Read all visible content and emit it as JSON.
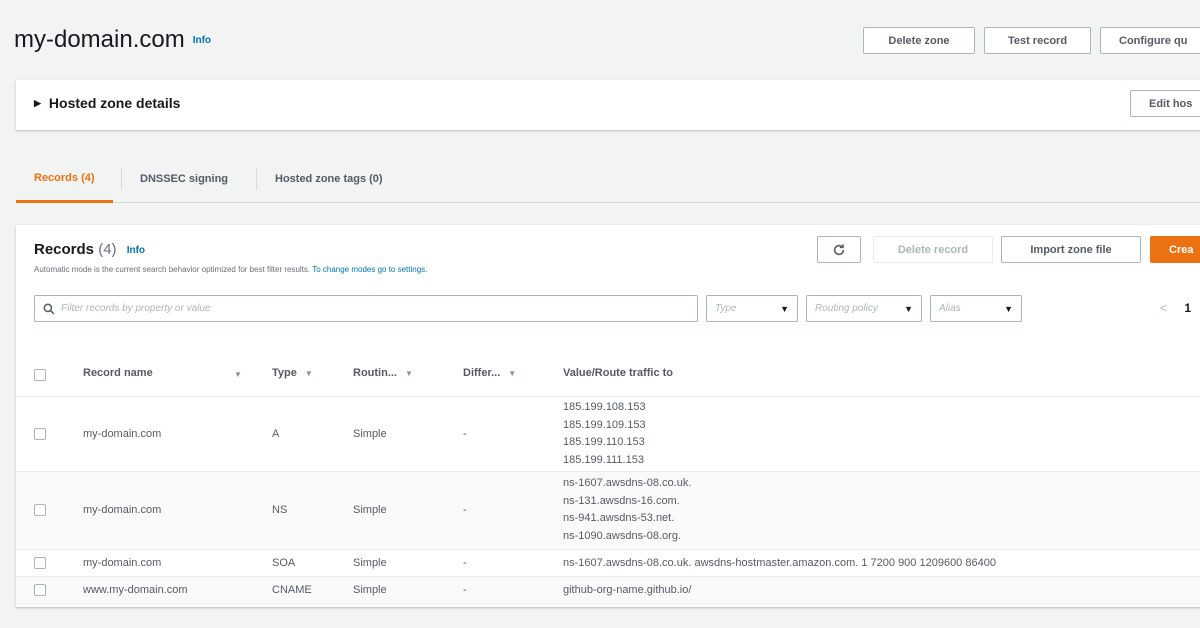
{
  "header": {
    "title": "my-domain.com",
    "info": "Info",
    "buttons": {
      "delete_zone": "Delete zone",
      "test_record": "Test record",
      "configure": "Configure qu"
    }
  },
  "details": {
    "toggle_label": "Hosted zone details",
    "edit_button": "Edit hos"
  },
  "tabs": [
    {
      "label": "Records (4)",
      "active": true
    },
    {
      "label": "DNSSEC signing",
      "active": false
    },
    {
      "label": "Hosted zone tags (0)",
      "active": false
    }
  ],
  "records": {
    "title": "Records",
    "count": "(4)",
    "info": "Info",
    "description": "Automatic mode is the current search behavior optimized for best filter results.",
    "description_link": "To change modes go to settings.",
    "refresh_icon": "refresh-icon",
    "delete_button": "Delete record",
    "import_button": "Import zone file",
    "create_button": "Crea",
    "search_placeholder": "Filter records by property or value",
    "search_value": "",
    "filters": {
      "type": "Type",
      "routing": "Routing policy",
      "alias": "Alias"
    },
    "pager": {
      "prev": "<",
      "page": "1"
    }
  },
  "table": {
    "columns": {
      "name": "Record name",
      "type": "Type",
      "routing": "Routin...",
      "differ": "Differ...",
      "value": "Value/Route traffic to"
    },
    "rows": [
      {
        "name": "my-domain.com",
        "type": "A",
        "routing": "Simple",
        "differ": "-",
        "values": [
          "185.199.108.153",
          "185.199.109.153",
          "185.199.110.153",
          "185.199.111.153"
        ]
      },
      {
        "name": "my-domain.com",
        "type": "NS",
        "routing": "Simple",
        "differ": "-",
        "values": [
          "ns-1607.awsdns-08.co.uk.",
          "ns-131.awsdns-16.com.",
          "ns-941.awsdns-53.net.",
          "ns-1090.awsdns-08.org."
        ]
      },
      {
        "name": "my-domain.com",
        "type": "SOA",
        "routing": "Simple",
        "differ": "-",
        "values": [
          "ns-1607.awsdns-08.co.uk. awsdns-hostmaster.amazon.com. 1 7200 900 1209600 86400"
        ]
      },
      {
        "name": "www.my-domain.com",
        "type": "CNAME",
        "routing": "Simple",
        "differ": "-",
        "values": [
          "github-org-name.github.io/"
        ]
      }
    ]
  },
  "colors": {
    "accent": "#ec7211",
    "link": "#0073bb",
    "background": "#f2f3f3"
  }
}
